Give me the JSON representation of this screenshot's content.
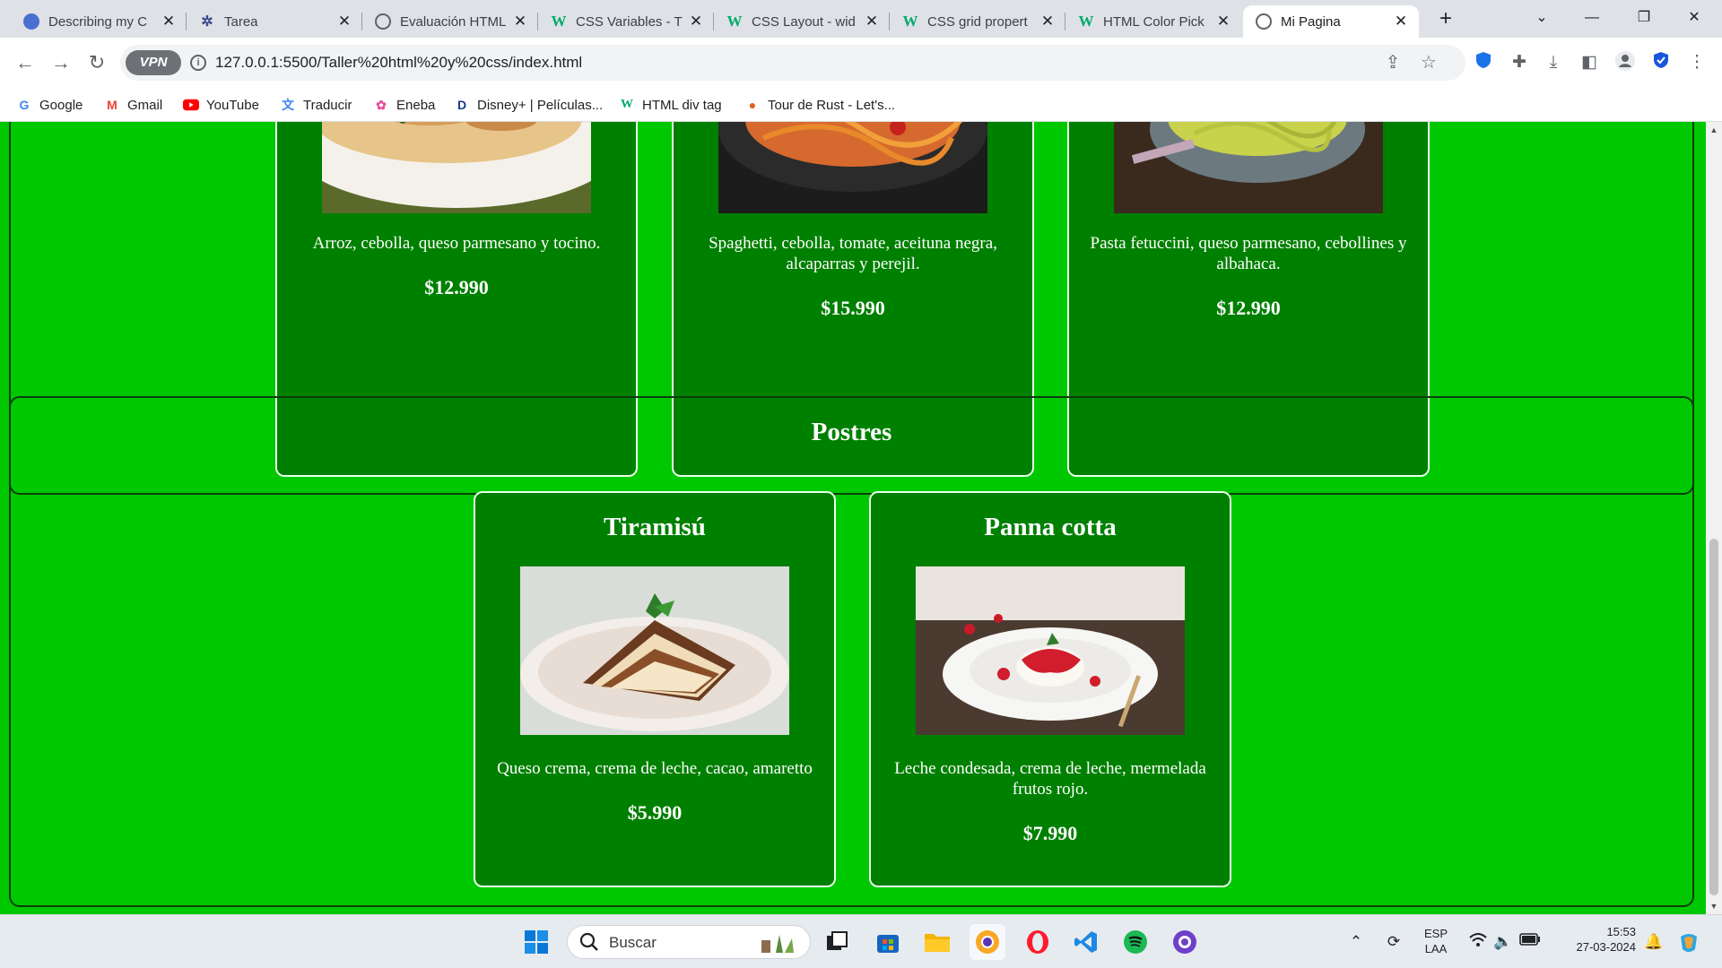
{
  "browser": {
    "tabs": [
      {
        "title": "Describing my C",
        "icon": "globe-icon",
        "active": false
      },
      {
        "title": "Tarea",
        "icon": "tarea-icon",
        "active": false
      },
      {
        "title": "Evaluación HTML",
        "icon": "globe-icon",
        "active": false
      },
      {
        "title": "CSS Variables - T",
        "icon": "w3schools-icon",
        "active": false
      },
      {
        "title": "CSS Layout - wid",
        "icon": "w3schools-icon",
        "active": false
      },
      {
        "title": "CSS grid propert",
        "icon": "w3schools-icon",
        "active": false
      },
      {
        "title": "HTML Color Pick",
        "icon": "w3schools-icon",
        "active": false
      },
      {
        "title": "Mi Pagina",
        "icon": "globe-icon",
        "active": true
      }
    ],
    "address": {
      "vpn_label": "VPN",
      "url": "127.0.0.1:5500/Taller%20html%20y%20css/index.html"
    },
    "bookmarks": [
      {
        "label": "Google",
        "icon": "google-icon"
      },
      {
        "label": "Gmail",
        "icon": "gmail-icon"
      },
      {
        "label": "YouTube",
        "icon": "youtube-icon"
      },
      {
        "label": "Traducir",
        "icon": "translate-icon"
      },
      {
        "label": "Eneba",
        "icon": "eneba-icon"
      },
      {
        "label": "Disney+ | Películas...",
        "icon": "disney-icon"
      },
      {
        "label": "HTML div tag",
        "icon": "w3schools-icon"
      },
      {
        "label": "Tour de Rust - Let's...",
        "icon": "rust-icon"
      }
    ]
  },
  "page": {
    "colors": {
      "background": "#00c800",
      "card": "#008000",
      "text": "#ffffff",
      "section_border": "#0a3d0a"
    },
    "main_dishes": [
      {
        "description": "Arroz, cebolla, queso parmesano y tocino.",
        "price": "$12.990",
        "image": "risotto-photo"
      },
      {
        "description": "Spaghetti, cebolla, tomate, aceituna negra, alcaparras y perejil.",
        "price": "$15.990",
        "image": "spaghetti-photo"
      },
      {
        "description": "Pasta fetuccini, queso parmesano, cebollines y albahaca.",
        "price": "$12.990",
        "image": "fettuccine-photo"
      }
    ],
    "desserts": {
      "heading": "Postres",
      "items": [
        {
          "name": "Tiramisú",
          "description": "Queso crema, crema de leche, cacao, amaretto",
          "price": "$5.990",
          "image": "tiramisu-photo"
        },
        {
          "name": "Panna cotta",
          "description": "Leche condesada, crema de leche, mermelada frutos rojo.",
          "price": "$7.990",
          "image": "panna-cotta-photo"
        }
      ]
    }
  },
  "taskbar": {
    "search_placeholder": "Buscar",
    "language_line1": "ESP",
    "language_line2": "LAA",
    "time": "15:53",
    "date": "27-03-2024",
    "apps": [
      "windows-start-icon",
      "task-view-icon",
      "microsoft-store-icon",
      "file-explorer-icon",
      "chrome-icon",
      "opera-icon",
      "vscode-icon",
      "spotify-icon",
      "github-desktop-icon"
    ]
  }
}
